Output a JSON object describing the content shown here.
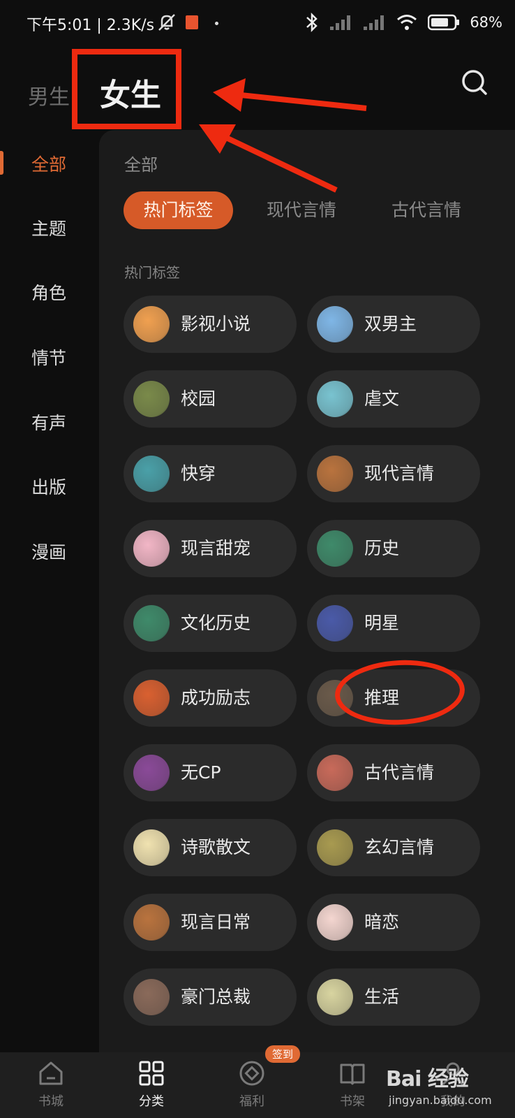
{
  "status_bar": {
    "left_text": "下午5:01 | 2.3K/s",
    "battery": "68%"
  },
  "header": {
    "tab_male": "男生",
    "tab_female": "女生"
  },
  "left_nav": {
    "items": [
      {
        "label": "全部",
        "active": true
      },
      {
        "label": "主题"
      },
      {
        "label": "角色"
      },
      {
        "label": "情节"
      },
      {
        "label": "有声"
      },
      {
        "label": "出版"
      },
      {
        "label": "漫画"
      }
    ]
  },
  "panel": {
    "title": "全部",
    "chips": [
      {
        "label": "热门标签",
        "active": true
      },
      {
        "label": "现代言情"
      },
      {
        "label": "古代言情"
      }
    ],
    "section_label": "热门标签",
    "tags": [
      {
        "label": "影视小说",
        "icon": "film-reel-icon",
        "color": "#f0a050"
      },
      {
        "label": "双男主",
        "icon": "sakura-icon",
        "color": "#7fb6e6"
      },
      {
        "label": "校园",
        "icon": "book-icon",
        "color": "#7a8a4a"
      },
      {
        "label": "虐文",
        "icon": "broken-heart-icon",
        "color": "#79c3d0"
      },
      {
        "label": "快穿",
        "icon": "hourglass-icon",
        "color": "#4aa0a8"
      },
      {
        "label": "现代言情",
        "icon": "flower-icon",
        "color": "#b9733e"
      },
      {
        "label": "现言甜宠",
        "icon": "ribbon-heart-icon",
        "color": "#f2b6c6"
      },
      {
        "label": "历史",
        "icon": "scroll-icon",
        "color": "#3f8a6a"
      },
      {
        "label": "文化历史",
        "icon": "scroll-icon",
        "color": "#3f8a6a"
      },
      {
        "label": "明星",
        "icon": "star-portrait-icon",
        "color": "#4a5aa8"
      },
      {
        "label": "成功励志",
        "icon": "medal-icon",
        "color": "#d96030"
      },
      {
        "label": "推理",
        "icon": "detective-icon",
        "color": "#6a5a4a"
      },
      {
        "label": "无CP",
        "icon": "girl-portrait-icon",
        "color": "#8a4a98"
      },
      {
        "label": "古代言情",
        "icon": "peach-icon",
        "color": "#c86a5a"
      },
      {
        "label": "诗歌散文",
        "icon": "poem-scroll-icon",
        "color": "#f0e2b0"
      },
      {
        "label": "玄幻言情",
        "icon": "lotus-icon",
        "color": "#a89a50"
      },
      {
        "label": "现言日常",
        "icon": "flower-icon",
        "color": "#b9733e"
      },
      {
        "label": "暗恋",
        "icon": "love-letter-icon",
        "color": "#f4d6d0"
      },
      {
        "label": "豪门总裁",
        "icon": "teacup-icon",
        "color": "#8a6a5a"
      },
      {
        "label": "生活",
        "icon": "coffee-cup-icon",
        "color": "#d8d4a0"
      }
    ]
  },
  "bottom_nav": {
    "items": [
      {
        "label": "书城"
      },
      {
        "label": "分类",
        "active": true
      },
      {
        "label": "福利",
        "badge": "签到"
      },
      {
        "label": "书架"
      },
      {
        "label": "我的"
      }
    ]
  },
  "watermark": {
    "brand": "Bai 经验",
    "url": "jingyan.baidu.com"
  }
}
